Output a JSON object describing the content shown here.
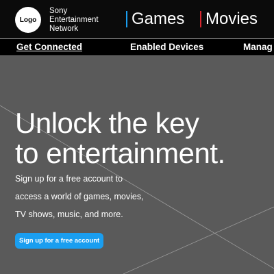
{
  "header": {
    "logo_text": "Logo",
    "brand_lines": [
      "Sony",
      "Entertainment",
      "Network"
    ],
    "nav": [
      {
        "label": "Games",
        "accent": "#1a9ef0"
      },
      {
        "label": "Movies",
        "accent": "#d8262e"
      }
    ]
  },
  "subnav": {
    "items": [
      "Get Connected",
      "Enabled Devices",
      "Manag"
    ]
  },
  "hero": {
    "headline_lines": [
      "Unlock the key",
      "to entertainment."
    ],
    "description_lines": [
      "Sign up for a free account to",
      "access a world of games, movies,",
      "TV shows, music, and more."
    ],
    "cta_label": "Sign up for a free account"
  },
  "colors": {
    "background": "#5a5a5a",
    "header": "#0b0b0b",
    "cta": "#1a9ef0"
  }
}
